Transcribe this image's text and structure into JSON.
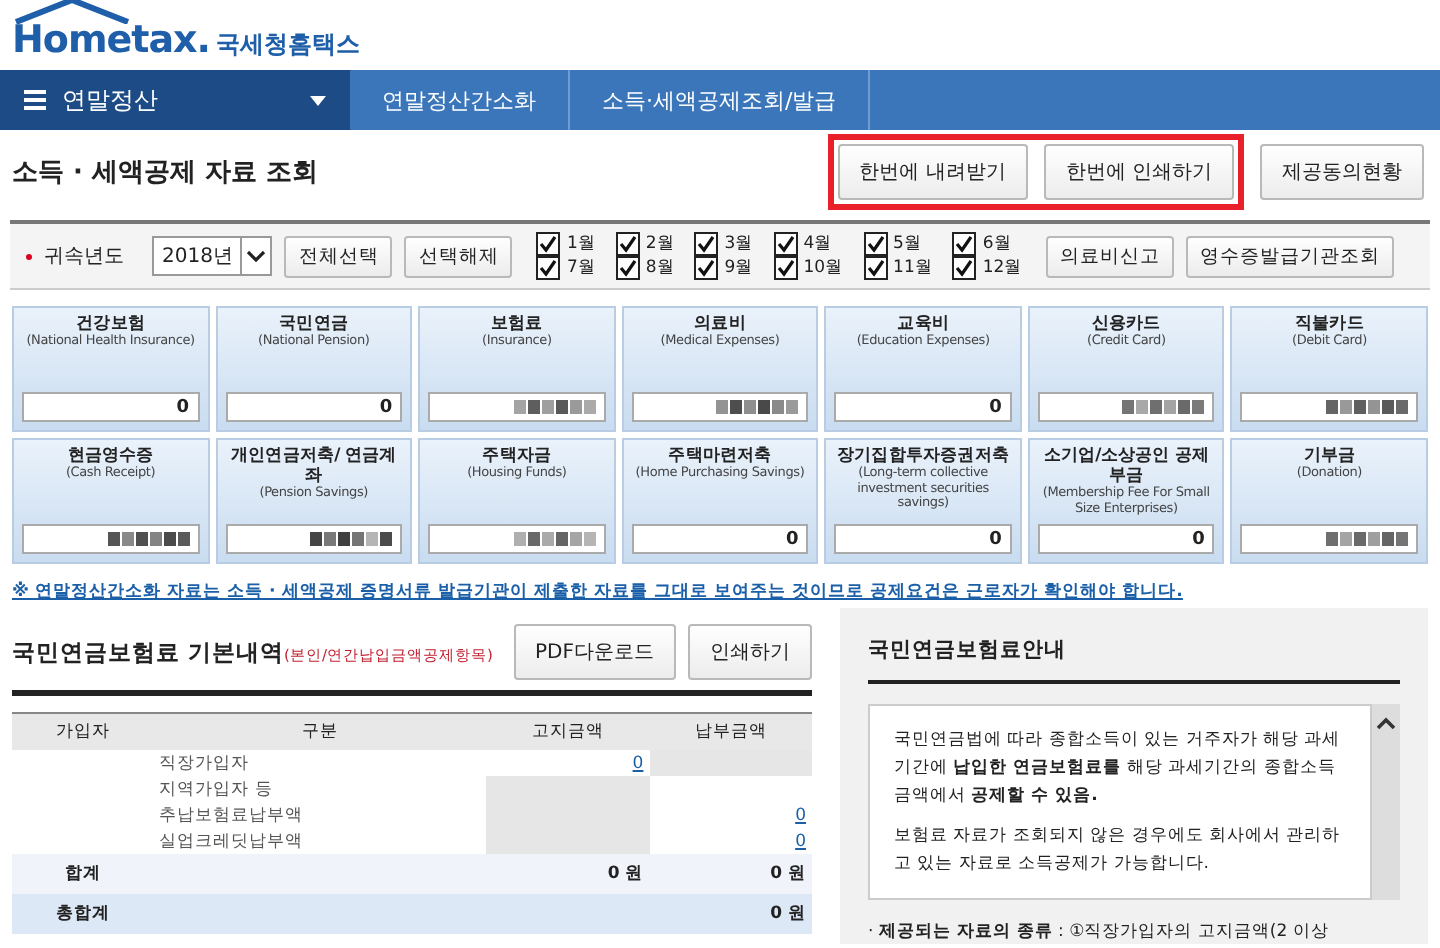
{
  "header": {
    "logo": "Hometax.",
    "logo_korean": "국세청홈택스"
  },
  "nav": {
    "menu": "연말정산",
    "breadcrumbs": [
      "연말정산간소화",
      "소득·세액공제조회/발급"
    ]
  },
  "page_title": "소득 · 세액공제 자료 조회",
  "top_buttons": [
    {
      "label": "한번에 내려받기",
      "highlighted": true
    },
    {
      "label": "한번에 인쇄하기",
      "highlighted": true
    },
    {
      "label": "제공동의현황",
      "highlighted": false
    }
  ],
  "filter": {
    "label": "귀속년도",
    "year": "2018년",
    "select_buttons": [
      "전체선택",
      "선택해제"
    ],
    "months": [
      {
        "label": "1월",
        "checked": true
      },
      {
        "label": "2월",
        "checked": true
      },
      {
        "label": "3월",
        "checked": true
      },
      {
        "label": "4월",
        "checked": true
      },
      {
        "label": "5월",
        "checked": true
      },
      {
        "label": "6월",
        "checked": true
      },
      {
        "label": "7월",
        "checked": true
      },
      {
        "label": "8월",
        "checked": true
      },
      {
        "label": "9월",
        "checked": true
      },
      {
        "label": "10월",
        "checked": true
      },
      {
        "label": "11월",
        "checked": true
      },
      {
        "label": "12월",
        "checked": true
      }
    ],
    "action_buttons": [
      "의료비신고",
      "영수증발급기관조회"
    ]
  },
  "cards": [
    {
      "title": "건강보험",
      "subtitle": "(National Health Insurance)",
      "value": "0",
      "masked": false
    },
    {
      "title": "국민연금",
      "subtitle": "(National Pension)",
      "value": "0",
      "masked": false
    },
    {
      "title": "보험료",
      "subtitle": "(Insurance)",
      "masked": true
    },
    {
      "title": "의료비",
      "subtitle": "(Medical Expenses)",
      "masked": true
    },
    {
      "title": "교육비",
      "subtitle": "(Education Expenses)",
      "value": "0",
      "masked": false
    },
    {
      "title": "신용카드",
      "subtitle": "(Credit Card)",
      "masked": true
    },
    {
      "title": "직불카드",
      "subtitle": "(Debit Card)",
      "masked": true
    },
    {
      "title": "현금영수증",
      "subtitle": "(Cash Receipt)",
      "masked": true
    },
    {
      "title": "개인연금저축/ 연금계좌",
      "subtitle": "(Pension Savings)",
      "masked": true
    },
    {
      "title": "주택자금",
      "subtitle": "(Housing Funds)",
      "masked": true
    },
    {
      "title": "주택마련저축",
      "subtitle": "(Home Purchasing Savings)",
      "value": "0",
      "masked": false
    },
    {
      "title": "장기집합투자증권저축",
      "subtitle": "(Long-term collective investment securities savings)",
      "value": "0",
      "masked": false
    },
    {
      "title": "소기업/소상공인 공제부금",
      "subtitle": "(Membership Fee For Small Size Enterprises)",
      "value": "0",
      "masked": false
    },
    {
      "title": "기부금",
      "subtitle": "(Donation)",
      "masked": true
    }
  ],
  "notice": "※ 연말정산간소화 자료는 소득 · 세액공제 증명서류 발급기관이 제출한 자료를 그대로 보여주는 것이므로 공제요건은 근로자가 확인해야 합니다.",
  "pension_section": {
    "title": "국민연금보험료 기본내역",
    "title_note": "(본인/연간납입금액공제항목)",
    "buttons": [
      "PDF다운로드",
      "인쇄하기"
    ],
    "table": {
      "columns": [
        "가입자",
        "구분",
        "고지금액",
        "납부금액"
      ],
      "rows": [
        {
          "kind": "item",
          "category": "직장가입자",
          "notice": "0",
          "notice_disabled": false,
          "paid_disabled": true
        },
        {
          "kind": "item",
          "category": "지역가입자 등",
          "notice_disabled": true,
          "paid_disabled": false
        },
        {
          "kind": "item",
          "category": "추납보험료납부액",
          "paid": "0",
          "notice_disabled": true,
          "paid_disabled": false
        },
        {
          "kind": "item",
          "category": "실업크레딧납부액",
          "paid": "0",
          "notice_disabled": true,
          "paid_disabled": false
        },
        {
          "kind": "total",
          "member": "합계",
          "notice": "0 원",
          "paid": "0 원"
        },
        {
          "kind": "grand_total",
          "member": "총합계",
          "paid": "0 원"
        }
      ]
    }
  },
  "guide": {
    "title": "국민연금보험료안내",
    "paragraphs": [
      "국민연금법에 따라 종합소득이 있는 거주자가 해당 과세기간에 **납입한 연금보험료를** 해당 과세기간의 종합소득금액에서 **공제할 수 있음.**",
      "보험료 자료가 조회되지 않은 경우에도 회사에서 관리하고 있는 자료로 소득공제가 가능합니다."
    ],
    "bullet": "· **제공되는 자료의 종류** : ①직장가입자의 고지금액(2 이상"
  }
}
